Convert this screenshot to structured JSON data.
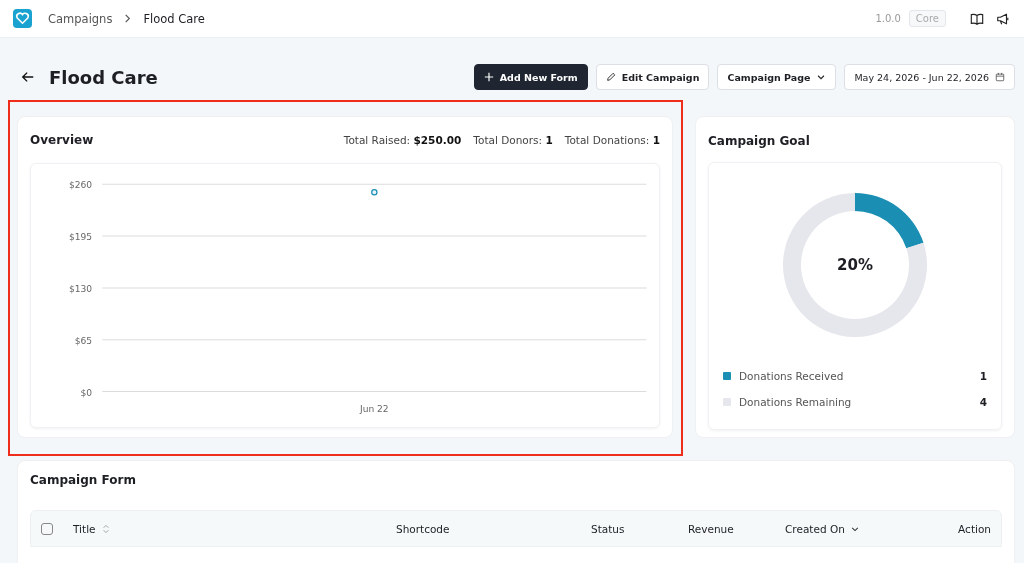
{
  "breadcrumb": [
    "Campaigns",
    "Flood Care"
  ],
  "version": "1.0.0",
  "edition": "Core",
  "page_title": "Flood Care",
  "actions": {
    "add_form": "Add New Form",
    "edit": "Edit Campaign",
    "page_menu": "Campaign Page",
    "date_range": "May 24, 2026 - Jun 22, 2026"
  },
  "overview": {
    "title": "Overview",
    "stats": [
      {
        "label": "Total Raised:",
        "value": "$250.00"
      },
      {
        "label": "Total Donors:",
        "value": "1"
      },
      {
        "label": "Total Donations:",
        "value": "1"
      }
    ],
    "chart_data": {
      "type": "line",
      "grid": true,
      "categories": [
        "Jun 22"
      ],
      "series": [
        {
          "color": "#1a8fb3",
          "marker": true,
          "values": [
            250
          ]
        }
      ],
      "ylim": [
        0,
        260
      ],
      "yticks": [
        {
          "value": 0,
          "label": "$0"
        },
        {
          "value": 65,
          "label": "$65"
        },
        {
          "value": 130,
          "label": "$130"
        },
        {
          "value": 195,
          "label": "$195"
        },
        {
          "value": 260,
          "label": "$260"
        }
      ]
    }
  },
  "goal": {
    "title": "Campaign Goal",
    "center_label": "20%",
    "chart_data": {
      "type": "donut",
      "categories": [
        "Donations Received",
        "Donations Remaining"
      ],
      "series": [
        {
          "values": [
            20,
            80
          ]
        }
      ]
    },
    "legend": [
      {
        "value": "1",
        "color": "#1a8fb3"
      },
      {
        "value": "4",
        "color": "#e6e7ec"
      }
    ]
  },
  "form_table": {
    "title": "Campaign Form",
    "select_all_checked": false,
    "columns": [
      {
        "label": "Title",
        "sortable": true,
        "sorted": false
      },
      {
        "label": "Shortcode",
        "sortable": false,
        "sorted": false
      },
      {
        "label": "Status",
        "sortable": false,
        "sorted": false
      },
      {
        "label": "Revenue",
        "sortable": false,
        "sorted": false
      },
      {
        "label": "Created On",
        "sorted": true
      },
      {
        "label": "Action",
        "sortable": false,
        "sorted": false
      }
    ]
  }
}
